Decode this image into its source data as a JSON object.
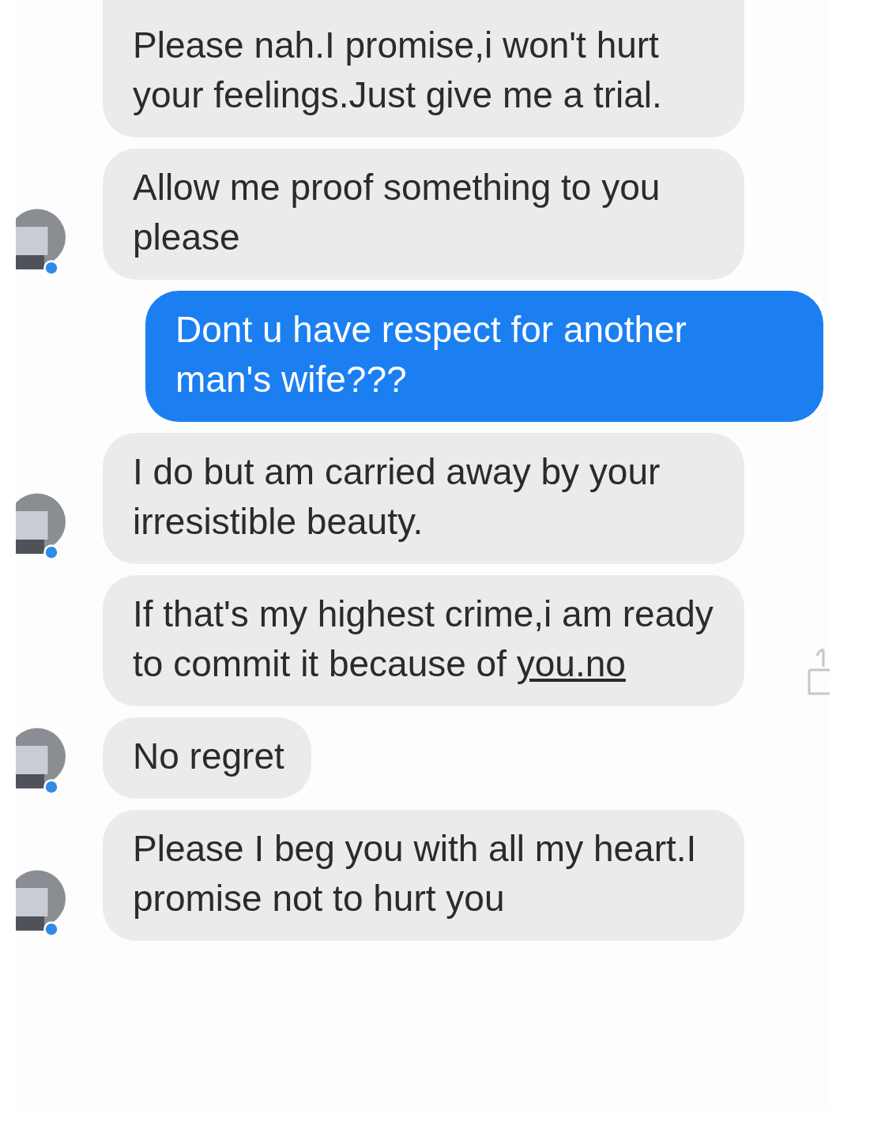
{
  "messages": [
    {
      "kind": "incoming",
      "avatar": false,
      "text": "Please nah.I promise,i won't hurt your feelings.Just give me a trial."
    },
    {
      "kind": "incoming",
      "avatar": true,
      "text": "Allow me proof something to you please"
    },
    {
      "kind": "outgoing",
      "avatar": false,
      "text": "Dont u have respect for another man's wife???"
    },
    {
      "kind": "incoming",
      "avatar": true,
      "text": "I do but am carried away by your irresistible beauty."
    },
    {
      "kind": "incoming",
      "avatar": false,
      "text": "If that's my highest crime,i am ready to commit it because of",
      "link": "you.no",
      "side_icon": true
    },
    {
      "kind": "incoming",
      "avatar": true,
      "text": "No regret"
    },
    {
      "kind": "incoming",
      "avatar": true,
      "text": "Please I beg you with all my heart.I promise not to hurt you"
    }
  ]
}
